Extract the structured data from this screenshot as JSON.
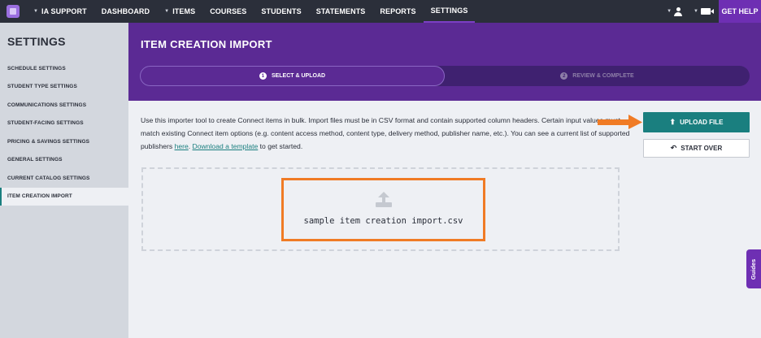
{
  "nav": {
    "items": [
      {
        "label": "IA SUPPORT",
        "caret": true
      },
      {
        "label": "DASHBOARD",
        "caret": false
      },
      {
        "label": "ITEMS",
        "caret": true
      },
      {
        "label": "COURSES",
        "caret": false
      },
      {
        "label": "STUDENTS",
        "caret": false
      },
      {
        "label": "STATEMENTS",
        "caret": false
      },
      {
        "label": "REPORTS",
        "caret": false
      },
      {
        "label": "SETTINGS",
        "caret": false,
        "active": true
      }
    ],
    "get_help": "GET HELP",
    "icons": [
      "user-icon",
      "video-icon"
    ]
  },
  "sidebar": {
    "title": "SETTINGS",
    "items": [
      {
        "label": "SCHEDULE SETTINGS"
      },
      {
        "label": "STUDENT TYPE SETTINGS"
      },
      {
        "label": "COMMUNICATIONS SETTINGS"
      },
      {
        "label": "STUDENT-FACING SETTINGS"
      },
      {
        "label": "PRICING & SAVINGS SETTINGS"
      },
      {
        "label": "GENERAL SETTINGS"
      },
      {
        "label": "CURRENT CATALOG SETTINGS"
      },
      {
        "label": "ITEM CREATION IMPORT",
        "active": true
      }
    ]
  },
  "main": {
    "title": "ITEM CREATION IMPORT",
    "steps": [
      {
        "num": "1",
        "label": "SELECT & UPLOAD",
        "active": true
      },
      {
        "num": "2",
        "label": "REVIEW & COMPLETE",
        "active": false
      }
    ],
    "description": {
      "text": "Use this importer tool to create Connect items in bulk. Import files must be in CSV format and contain supported column headers. Certain input values must match existing Connect item options (e.g. content access method, content type, delivery method, publisher name, etc.). You can see a current list of supported publishers ",
      "link1": "here",
      "mid": ". ",
      "link2": "Download a template",
      "end": " to get started."
    },
    "file_name": "sample item creation import.csv",
    "upload_button": "UPLOAD FILE",
    "start_over_button": "START OVER"
  },
  "guides": "Guides",
  "colors": {
    "nav_bg": "#2b2f3a",
    "header_purple": "#5b2a94",
    "accent_teal": "#1a7f7f",
    "highlight_orange": "#f07b25",
    "help_purple": "#6e2fb3"
  }
}
